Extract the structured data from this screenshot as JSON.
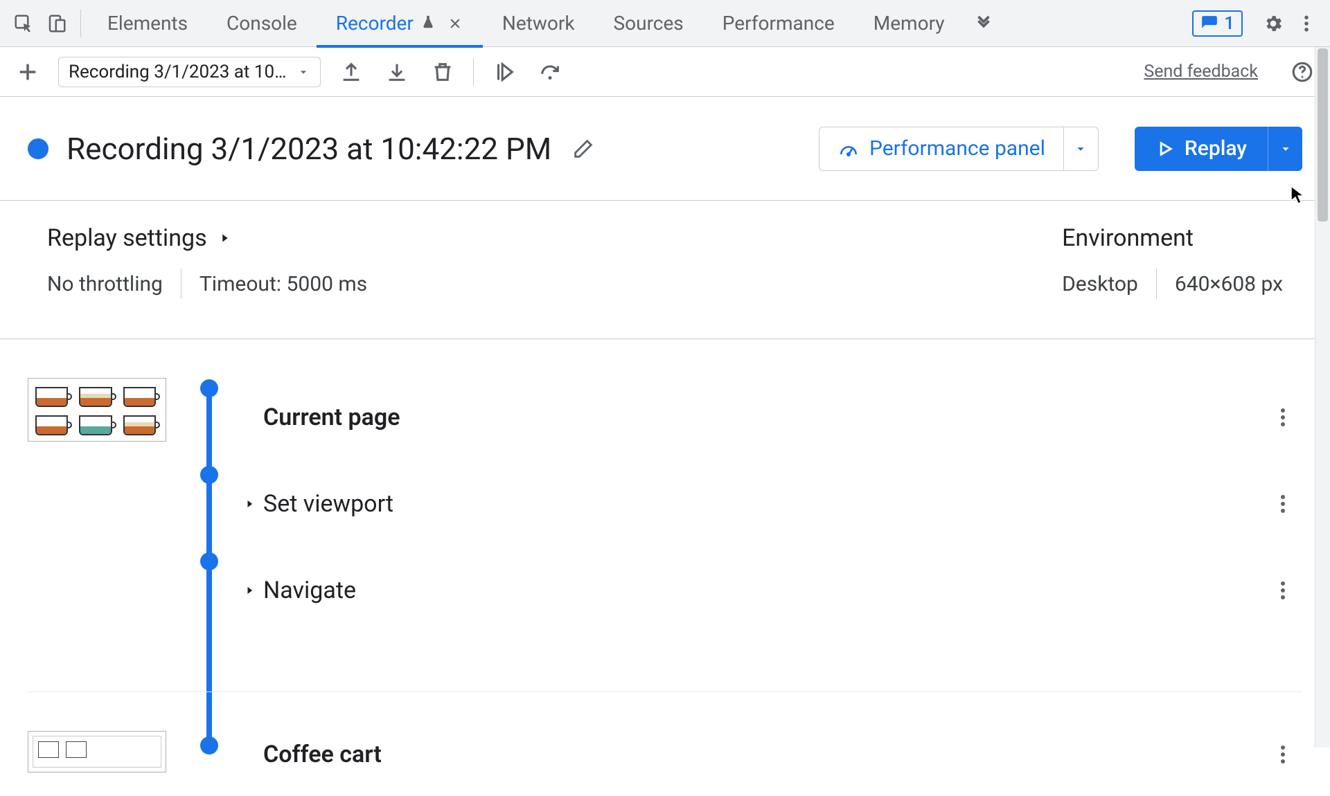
{
  "tabs": {
    "elements": "Elements",
    "console": "Console",
    "recorder": "Recorder",
    "network": "Network",
    "sources": "Sources",
    "performance": "Performance",
    "memory": "Memory"
  },
  "issues_count": "1",
  "subbar": {
    "recording_label": "Recording 3/1/2023 at 10…",
    "feedback": "Send feedback"
  },
  "title": "Recording 3/1/2023 at 10:42:22 PM",
  "perf_panel": "Performance panel",
  "replay": "Replay",
  "replay_settings_heading": "Replay settings",
  "environment_heading": "Environment",
  "throttling": "No throttling",
  "timeout": "Timeout: 5000 ms",
  "env_device": "Desktop",
  "env_viewport": "640×608 px",
  "steps": {
    "current_page": "Current page",
    "set_viewport": "Set viewport",
    "navigate": "Navigate",
    "coffee_cart": "Coffee cart"
  }
}
